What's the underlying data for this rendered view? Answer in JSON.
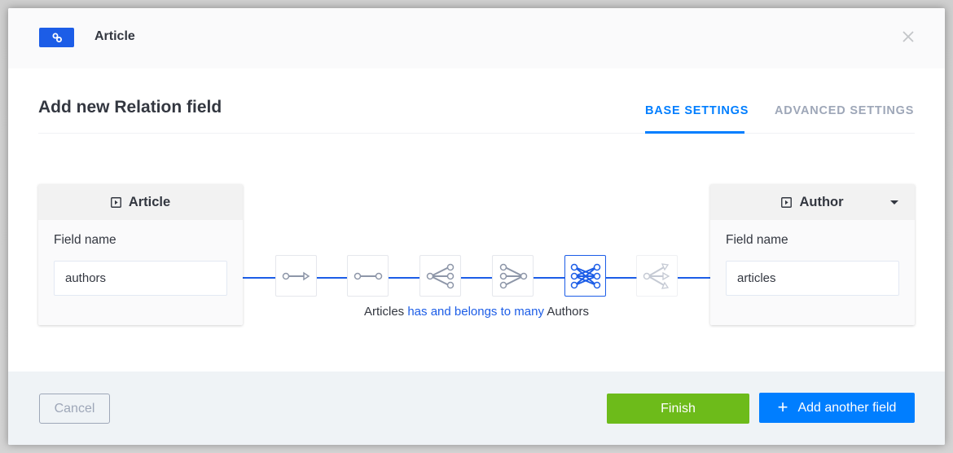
{
  "header": {
    "badge_icon": "link-icon",
    "title": "Article",
    "close_icon": "close-icon"
  },
  "main": {
    "title": "Add new Relation field",
    "tabs": [
      {
        "label": "BASE SETTINGS",
        "active": true
      },
      {
        "label": "ADVANCED SETTINGS",
        "active": false
      }
    ]
  },
  "left_model": {
    "name": "Article",
    "icon": "content-type-icon",
    "field_label": "Field name",
    "field_value": "authors"
  },
  "right_model": {
    "name": "Author",
    "icon": "content-type-icon",
    "dropdown_icon": "caret-down-icon",
    "field_label": "Field name",
    "field_value": "articles"
  },
  "relations": [
    {
      "name": "one-way",
      "icon": "one-way-icon",
      "selected": false,
      "enabled": true
    },
    {
      "name": "one-to-one",
      "icon": "one-to-one-icon",
      "selected": false,
      "enabled": true
    },
    {
      "name": "one-to-many",
      "icon": "one-to-many-icon",
      "selected": false,
      "enabled": true
    },
    {
      "name": "many-to-one",
      "icon": "many-to-one-icon",
      "selected": false,
      "enabled": true
    },
    {
      "name": "many-to-many",
      "icon": "many-to-many-icon",
      "selected": true,
      "enabled": true
    },
    {
      "name": "many-way",
      "icon": "many-way-icon",
      "selected": false,
      "enabled": false
    }
  ],
  "relation_sentence": {
    "left": "Articles",
    "relation": "has and belongs to many",
    "right": "Authors"
  },
  "footer": {
    "cancel_label": "Cancel",
    "finish_label": "Finish",
    "add_label": "Add another field",
    "add_icon": "plus-icon"
  },
  "colors": {
    "accent": "#007eff",
    "relation_blue": "#1c5de7",
    "finish_green": "#6dbb1a",
    "muted": "#9ea7b8",
    "text": "#333740"
  }
}
